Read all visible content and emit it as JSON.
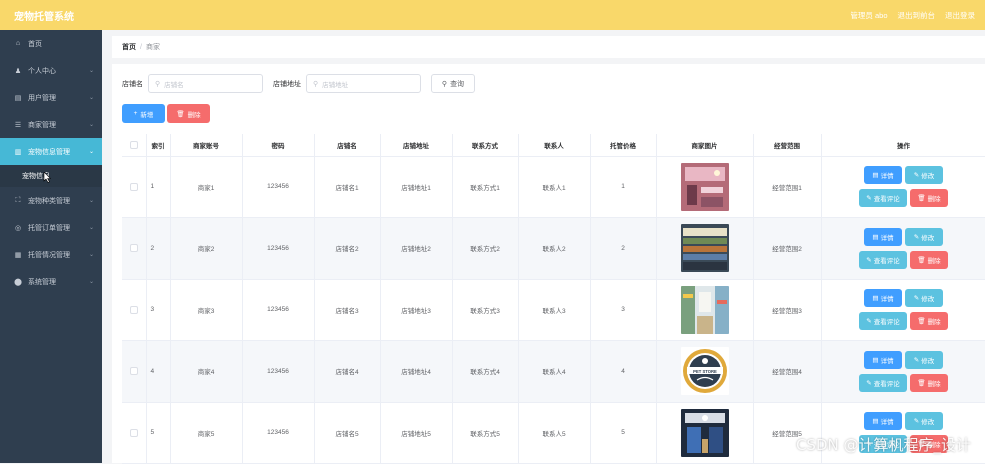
{
  "app": {
    "title": "宠物托管系统"
  },
  "topbar": {
    "links": [
      "管理员 abo",
      "退出到前台",
      "退出登录"
    ]
  },
  "sidebar": {
    "items": [
      {
        "label": "首页",
        "icon": "home-icon",
        "glyph": "⌂",
        "chevron": false
      },
      {
        "label": "个人中心",
        "icon": "user-icon",
        "glyph": "♟",
        "chevron": true
      },
      {
        "label": "用户管理",
        "icon": "card-icon",
        "glyph": "▤",
        "chevron": true
      },
      {
        "label": "商家管理",
        "icon": "list-icon",
        "glyph": "☰",
        "chevron": true
      },
      {
        "label": "宠物信息管理",
        "icon": "chart-icon",
        "glyph": "▥",
        "chevron": true,
        "active": true
      },
      {
        "label": "宠物种类管理",
        "icon": "frame-icon",
        "glyph": "⛶",
        "chevron": true
      },
      {
        "label": "托管订单管理",
        "icon": "target-icon",
        "glyph": "◎",
        "chevron": true
      },
      {
        "label": "托管情况管理",
        "icon": "doc-icon",
        "glyph": "▦",
        "chevron": true
      },
      {
        "label": "系统管理",
        "icon": "pin-icon",
        "glyph": "⬤",
        "chevron": true
      }
    ],
    "submenu": {
      "label": "宠物信息"
    }
  },
  "breadcrumb": {
    "home": "首页",
    "separator": "/",
    "current": "商家"
  },
  "search": {
    "shop_name_label": "店铺名",
    "shop_name_placeholder": "店铺名",
    "shop_address_label": "店铺地址",
    "shop_address_placeholder": "店铺地址",
    "query_label": "查询"
  },
  "actions": {
    "add_label": "新增",
    "delete_label": "删除"
  },
  "table": {
    "headers": [
      "索引",
      "商家账号",
      "密码",
      "店铺名",
      "店铺地址",
      "联系方式",
      "联系人",
      "托管价格",
      "商家图片",
      "经营范围",
      "操作"
    ],
    "rows": [
      {
        "index": "1",
        "account": "商家1",
        "password": "123456",
        "shop_name": "店铺名1",
        "shop_address": "店铺地址1",
        "contact": "联系方式1",
        "contact_person": "联系人1",
        "price": "1",
        "image": "shop-interior-pink",
        "scope": "经营范围1"
      },
      {
        "index": "2",
        "account": "商家2",
        "password": "123456",
        "shop_name": "店铺名2",
        "shop_address": "店铺地址2",
        "contact": "联系方式2",
        "contact_person": "联系人2",
        "price": "2",
        "image": "shop-interior-shelves",
        "scope": "经营范围2"
      },
      {
        "index": "3",
        "account": "商家3",
        "password": "123456",
        "shop_name": "店铺名3",
        "shop_address": "店铺地址3",
        "contact": "联系方式3",
        "contact_person": "联系人3",
        "price": "3",
        "image": "shop-interior-aisle",
        "scope": "经营范围3"
      },
      {
        "index": "4",
        "account": "商家4",
        "password": "123456",
        "shop_name": "店铺名4",
        "shop_address": "店铺地址4",
        "contact": "联系方式4",
        "contact_person": "联系人4",
        "price": "4",
        "image": "pet-store-logo",
        "scope": "经营范围4"
      },
      {
        "index": "5",
        "account": "商家5",
        "password": "123456",
        "shop_name": "店铺名5",
        "shop_address": "店铺地址5",
        "contact": "联系方式5",
        "contact_person": "联系人5",
        "price": "5",
        "image": "shop-interior-blue",
        "scope": "经营范围5"
      }
    ],
    "row_actions": {
      "detail": "详情",
      "edit": "修改",
      "comment": "查看评论",
      "delete": "删除"
    }
  },
  "logo_text": "PET STORE",
  "watermark": "CSDN @计算机程序_设计",
  "colors": {
    "topbar": "#f9d86a",
    "sidebar": "#2f3e4f",
    "active": "#46b8d6",
    "primary": "#409eff",
    "danger": "#f56c6c",
    "info": "#5cc2e0"
  }
}
